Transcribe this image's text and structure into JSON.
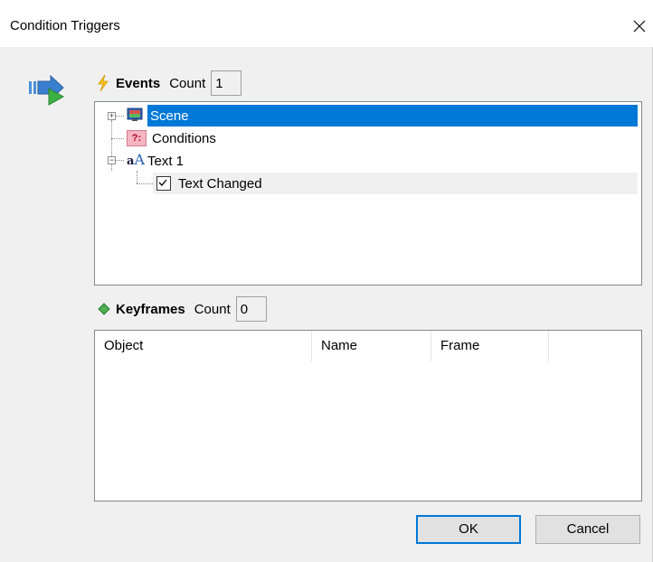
{
  "window": {
    "title": "Condition Triggers",
    "close_glyph": "✕"
  },
  "events": {
    "label": "Events",
    "count_label": "Count",
    "count_value": "1",
    "tree": {
      "scene": "Scene",
      "conditions": "Conditions",
      "conditions_icon_text": "?:",
      "text1": "Text 1",
      "text_changed": "Text Changed"
    }
  },
  "keyframes": {
    "label": "Keyframes",
    "count_label": "Count",
    "count_value": "0",
    "columns": [
      "Object",
      "Name",
      "Frame"
    ]
  },
  "buttons": {
    "ok": "OK",
    "cancel": "Cancel"
  },
  "colors": {
    "selection": "#0078d7",
    "default_button_border": "#0078d7",
    "dialog_bg": "#f0f0f0"
  }
}
